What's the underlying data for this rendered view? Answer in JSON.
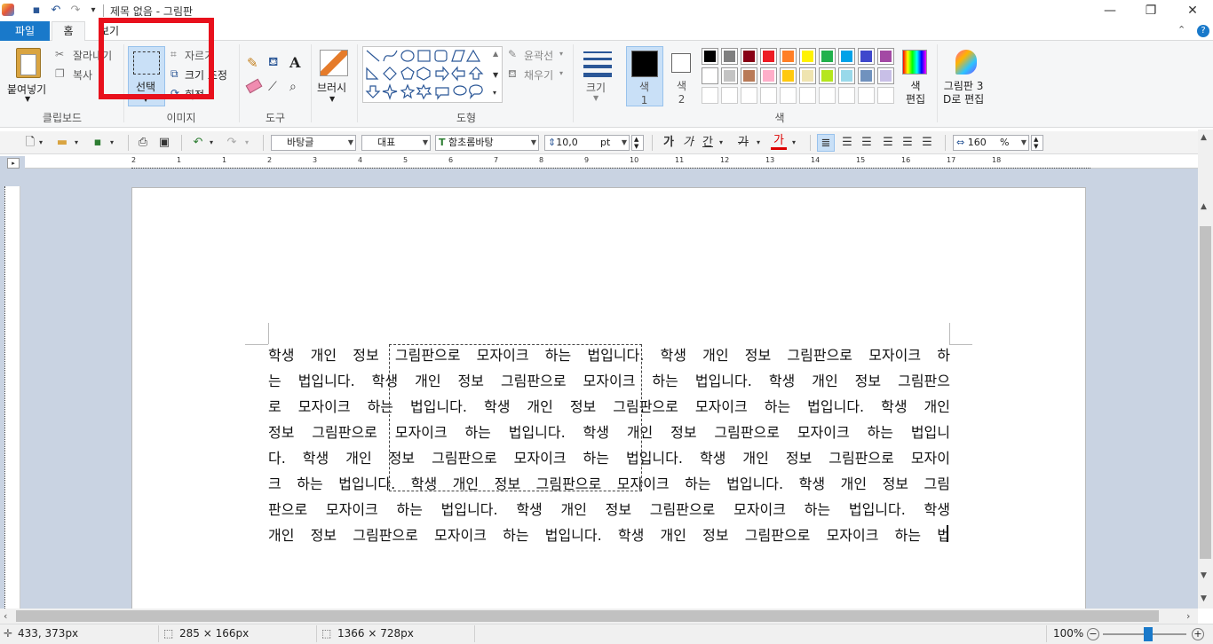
{
  "window": {
    "title": "제목 없음 - 그림판"
  },
  "tabs": {
    "file": "파일",
    "home": "홈",
    "view": "보기"
  },
  "ribbon": {
    "clipboard": {
      "paste": "붙여넣기",
      "cut": "잘라내기",
      "copy": "복사",
      "group": "클립보드"
    },
    "image": {
      "select": "선택",
      "crop": "자르기",
      "resize": "크기 조정",
      "rotate": "회전",
      "group": "이미지"
    },
    "tools": {
      "group": "도구"
    },
    "brushes": {
      "label": "브러시"
    },
    "shapes": {
      "outline": "윤곽선",
      "fill": "채우기",
      "group": "도형"
    },
    "size": {
      "label": "크기"
    },
    "colors": {
      "color1": "색\n1",
      "color2": "색\n2",
      "group": "색",
      "edit": "색\n편집",
      "palette": [
        "#000000",
        "#7f7f7f",
        "#880015",
        "#ed1c24",
        "#ff7f27",
        "#fff200",
        "#22b14c",
        "#00a2e8",
        "#3f48cc",
        "#a349a4",
        "#ffffff",
        "#c3c3c3",
        "#b97a57",
        "#ffaec9",
        "#ffc90e",
        "#efe4b0",
        "#b5e61d",
        "#99d9ea",
        "#7092be",
        "#c8bfe7"
      ]
    },
    "paint3d": {
      "label": "그림판 3\nD로 편집"
    }
  },
  "format": {
    "font_lang": "바탕글",
    "style": "대표",
    "font": "함초롬바탕",
    "size": "10,0",
    "unit": "pt",
    "bold": "가",
    "italic": "가",
    "underline": "간",
    "strike": "가",
    "color": "가",
    "zoom": "160",
    "zoom_unit": "%"
  },
  "document": {
    "lines": [
      "학생 개인 정보 그림판으로 모자이크 하는 법입니다. 학생 개인 정보 그림판으로 모자이크 하",
      "는 법입니다. 학생 개인 정보 그림판으로 모자이크 하는 법입니다. 학생 개인 정보 그림판으",
      "로 모자이크 하는 법입니다. 학생 개인 정보 그림판으로 모자이크 하는 법입니다. 학생 개인",
      "정보 그림판으로 모자이크 하는 법입니다. 학생 개인 정보 그림판으로 모자이크 하는 법입니",
      "다. 학생 개인 정보 그림판으로 모자이크 하는 법입니다. 학생 개인 정보 그림판으로 모자이",
      "크 하는 법입니다. 학생 개인 정보 그림판으로 모자이크 하는 법입니다. 학생 개인 정보 그림",
      "판으로 모자이크 하는 법입니다. 학생 개인 정보 그림판으로 모자이크 하는 법입니다. 학생",
      "개인 정보 그림판으로 모자이크 하는 법입니다. 학생 개인 정보 그림판으로 모자이크 하는 법"
    ]
  },
  "ruler": {
    "h_ticks": [
      "2",
      "1",
      "1",
      "2",
      "3",
      "4",
      "5",
      "6",
      "7",
      "8",
      "9",
      "10",
      "11",
      "12",
      "13",
      "14",
      "15",
      "16",
      "17",
      "18"
    ]
  },
  "status": {
    "cursor": "433, 373px",
    "selection": "285 × 166px",
    "canvas": "1366 × 728px",
    "zoom": "100%"
  },
  "accent": {
    "file_tab": "#1979ca",
    "highlight": "#e8101c"
  }
}
